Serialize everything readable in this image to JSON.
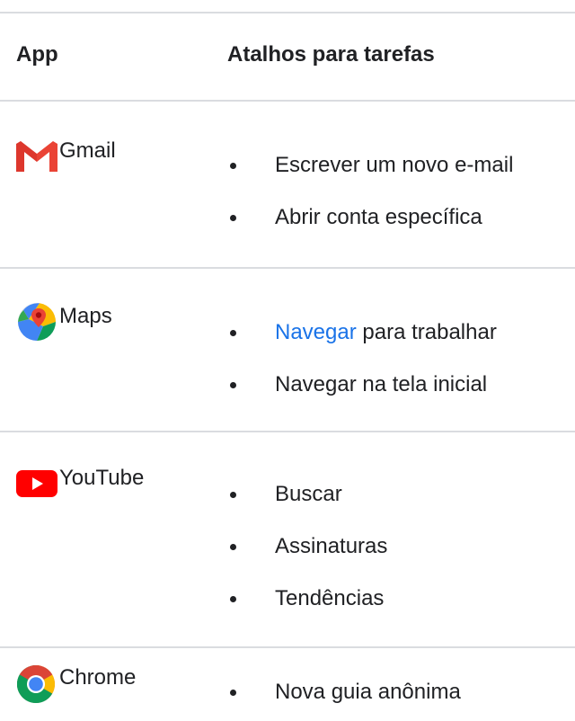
{
  "table": {
    "headers": {
      "app": "App",
      "shortcuts": "Atalhos para tarefas"
    },
    "rows": [
      {
        "app": "Gmail",
        "icon": "gmail-icon",
        "shortcuts": [
          {
            "text": "Escrever um novo e-mail"
          },
          {
            "text": "Abrir conta específica"
          }
        ]
      },
      {
        "app": "Maps",
        "icon": "maps-icon",
        "shortcuts": [
          {
            "link": "Navegar",
            "text": " para trabalhar"
          },
          {
            "text": "Navegar na tela inicial"
          }
        ]
      },
      {
        "app": "YouTube",
        "icon": "youtube-icon",
        "shortcuts": [
          {
            "text": "Buscar"
          },
          {
            "text": "Assinaturas"
          },
          {
            "text": "Tendências"
          }
        ]
      },
      {
        "app": "Chrome",
        "icon": "chrome-icon",
        "shortcuts": [
          {
            "text": "Nova guia anônima"
          }
        ]
      }
    ]
  },
  "colors": {
    "link": "#1a73e8",
    "divider": "#dadce0",
    "text": "#202124"
  }
}
